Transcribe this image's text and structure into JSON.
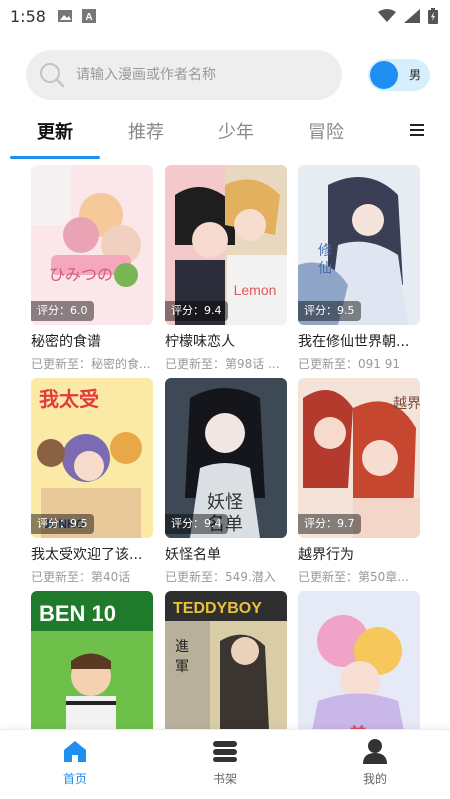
{
  "status_bar": {
    "time": "1:58"
  },
  "search": {
    "placeholder": "请输入漫画或作者名称"
  },
  "gender_toggle": {
    "label": "男"
  },
  "tabs": [
    {
      "label": "更新",
      "active": true
    },
    {
      "label": "推荐",
      "active": false
    },
    {
      "label": "少年",
      "active": false
    },
    {
      "label": "冒险",
      "active": false
    }
  ],
  "comics": [
    {
      "title": "秘密的食谱",
      "rating": "评分：6.0",
      "update": "已更新至：秘密的食..."
    },
    {
      "title": "柠檬味恋人",
      "rating": "评分：9.4",
      "update": "已更新至：第98话 ..."
    },
    {
      "title": "我在修仙世界朝...",
      "rating": "评分：9.5",
      "update": "已更新至：091 91"
    },
    {
      "title": "我太受欢迎了该...",
      "rating": "评分：9.5",
      "update": "已更新至：第40话"
    },
    {
      "title": "妖怪名单",
      "rating": "评分：9.4",
      "update": "已更新至：549.潜入"
    },
    {
      "title": "越界行为",
      "rating": "评分：9.7",
      "update": "已更新至：第50章..."
    },
    {
      "title": "",
      "rating": "",
      "update": ""
    },
    {
      "title": "",
      "rating": "",
      "update": ""
    },
    {
      "title": "",
      "rating": "",
      "update": ""
    }
  ],
  "bottom_nav": [
    {
      "label": "首页",
      "active": true
    },
    {
      "label": "书架",
      "active": false
    },
    {
      "label": "我的",
      "active": false
    }
  ],
  "colors": {
    "accent": "#1e8ff0",
    "search_bg": "#eeeeee",
    "toggle_bg": "#d6f0fb"
  }
}
